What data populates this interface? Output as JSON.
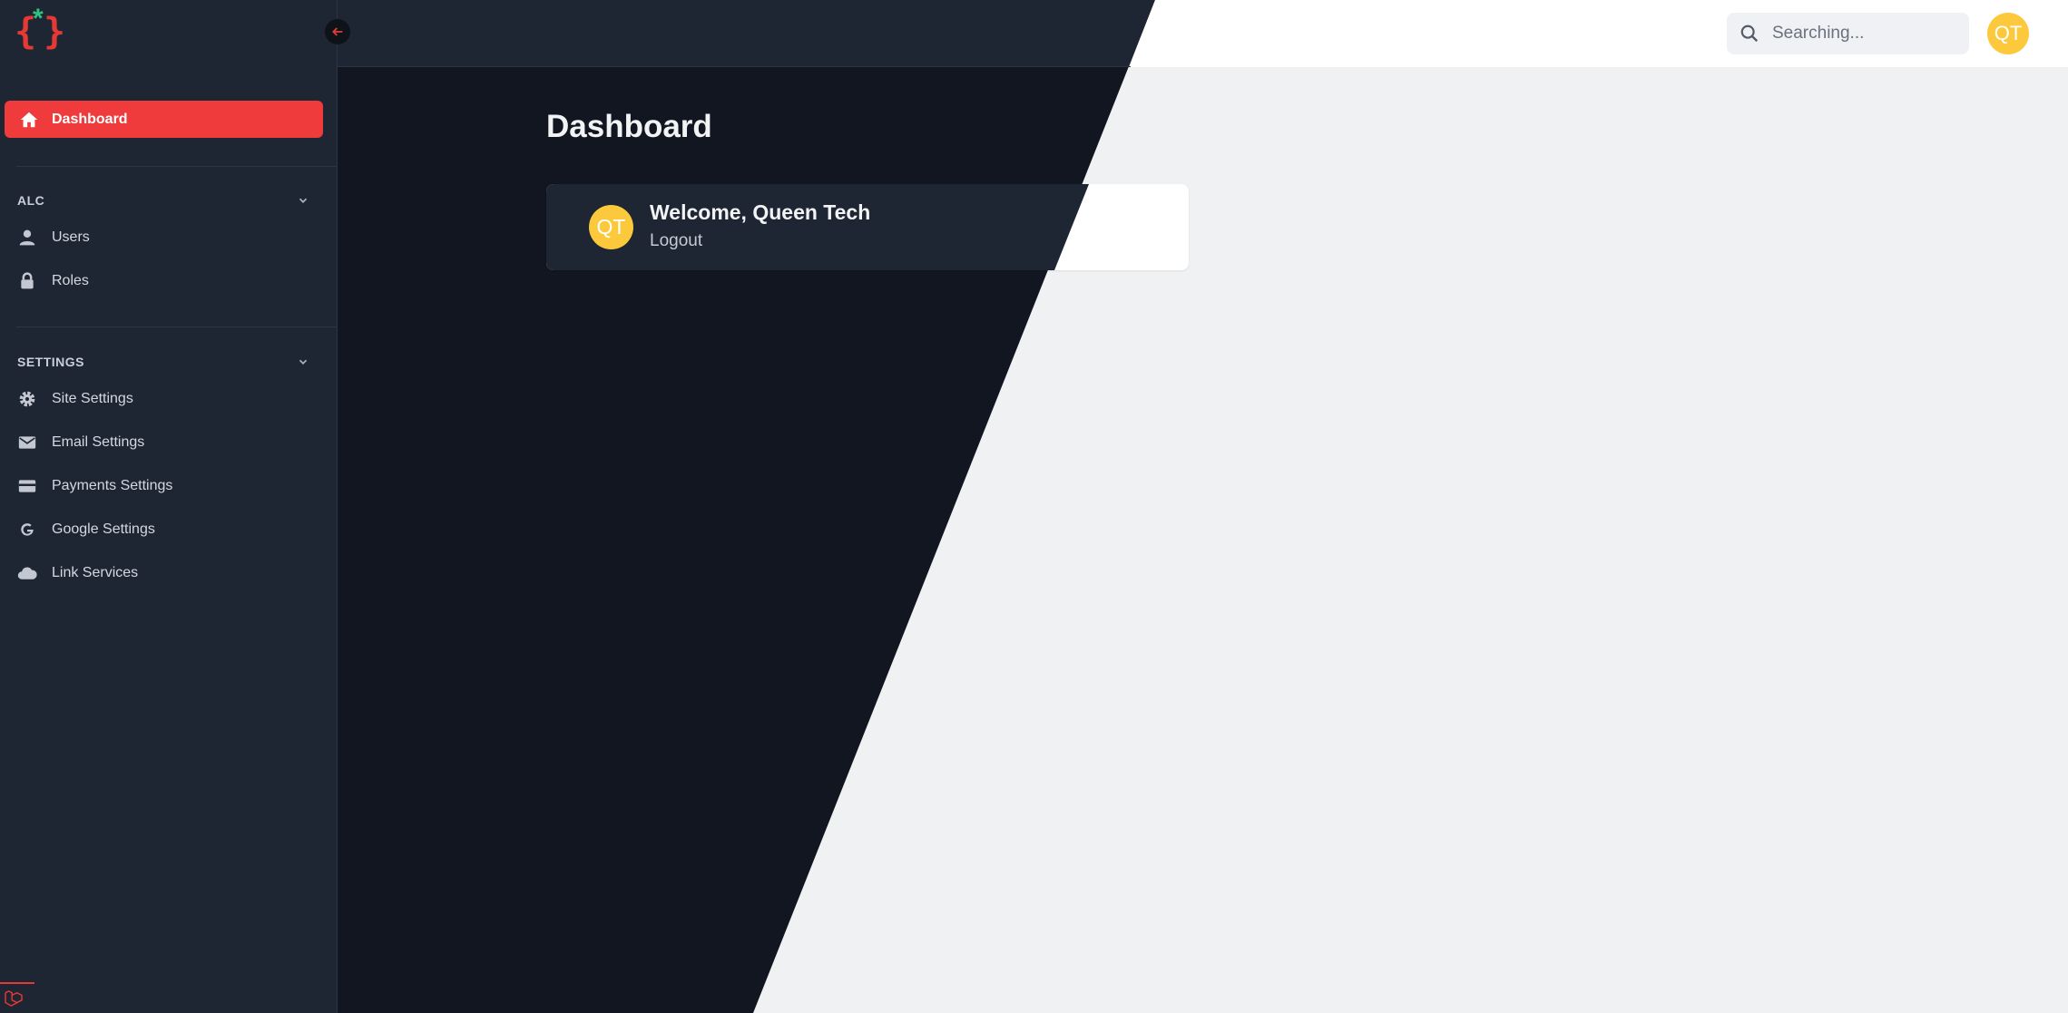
{
  "sidebar": {
    "logo": {
      "left_brace": "{",
      "star": "*",
      "right_brace": "}"
    },
    "active_item": {
      "label": "Dashboard",
      "icon": "home-icon"
    },
    "sections": [
      {
        "title": "ALC",
        "items": [
          {
            "label": "Users",
            "icon": "user-icon"
          },
          {
            "label": "Roles",
            "icon": "lock-icon"
          }
        ]
      },
      {
        "title": "SETTINGS",
        "items": [
          {
            "label": "Site Settings",
            "icon": "gear-icon"
          },
          {
            "label": "Email Settings",
            "icon": "mail-icon"
          },
          {
            "label": "Payments Settings",
            "icon": "credit-card-icon"
          },
          {
            "label": "Google Settings",
            "icon": "google-icon"
          },
          {
            "label": "Link Services",
            "icon": "cloud-icon"
          }
        ]
      }
    ]
  },
  "header": {
    "search_placeholder": "Searching...",
    "avatar_initials": "QT"
  },
  "main": {
    "title": "Dashboard",
    "welcome": {
      "avatar_initials": "QT",
      "greeting": "Welcome, Queen Tech",
      "logout_label": "Logout"
    }
  },
  "colors": {
    "accent": "#ef3b3b",
    "avatar": "#fcc93c",
    "sidebar_bg": "#1f2633",
    "dark_bg": "#111621",
    "light_bg": "#f0f1f3"
  }
}
